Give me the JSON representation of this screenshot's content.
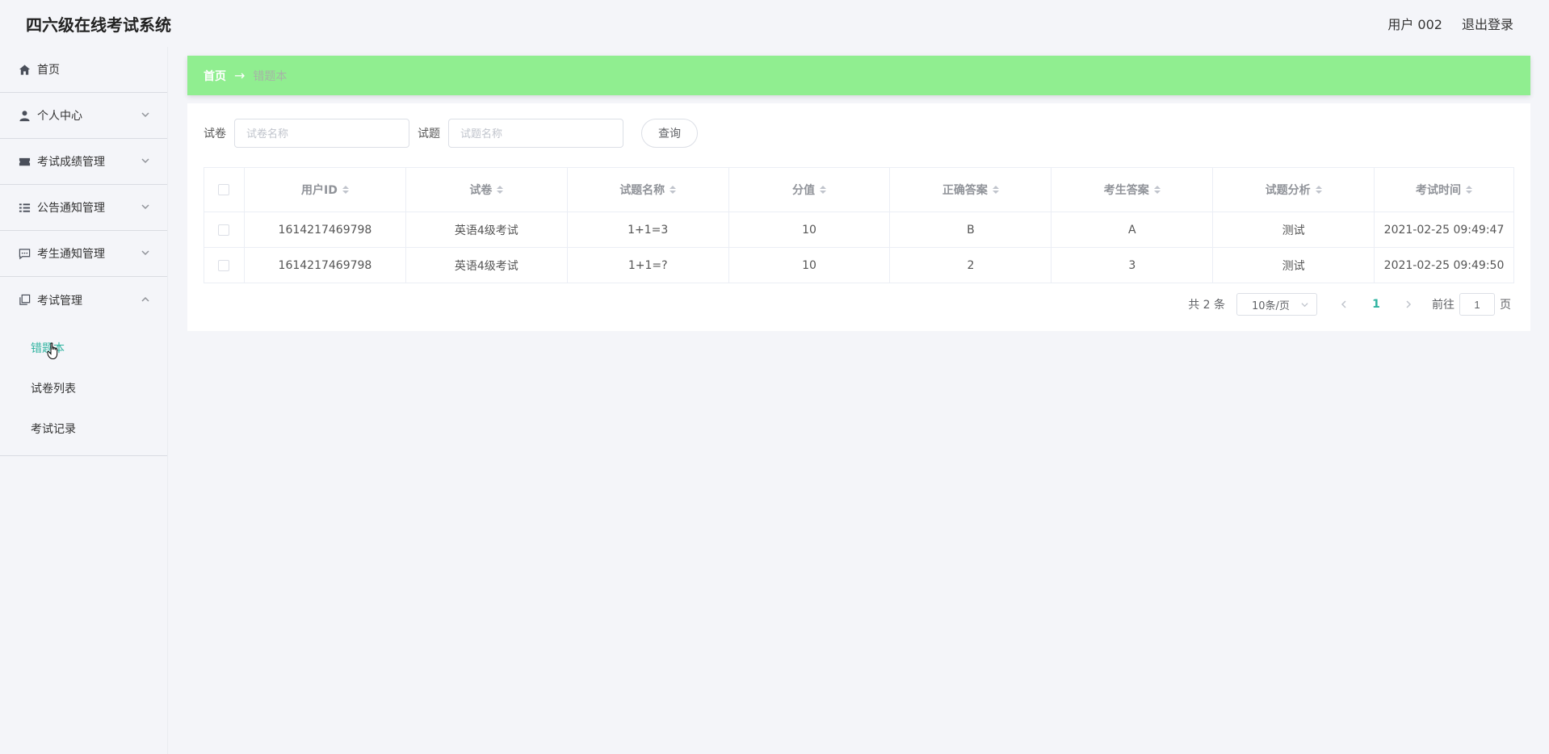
{
  "header": {
    "app_title": "四六级在线考试系统",
    "user_label": "用户 002",
    "logout_label": "退出登录"
  },
  "sidebar": {
    "items": [
      {
        "label": "首页",
        "icon": "home-icon"
      },
      {
        "label": "个人中心",
        "icon": "user-icon"
      },
      {
        "label": "考试成绩管理",
        "icon": "ticket-icon"
      },
      {
        "label": "公告通知管理",
        "icon": "list-icon"
      },
      {
        "label": "考生通知管理",
        "icon": "chat-icon"
      },
      {
        "label": "考试管理",
        "icon": "copy-icon"
      }
    ],
    "submenu": [
      {
        "label": "错题本",
        "active": true
      },
      {
        "label": "试卷列表"
      },
      {
        "label": "考试记录"
      }
    ]
  },
  "breadcrumb": {
    "home": "首页",
    "separator": "→",
    "current": "错题本"
  },
  "search": {
    "paper_label": "试卷",
    "paper_placeholder": "试卷名称",
    "question_label": "试题",
    "question_placeholder": "试题名称",
    "query_button": "查询"
  },
  "table": {
    "columns": [
      "用户ID",
      "试卷",
      "试题名称",
      "分值",
      "正确答案",
      "考生答案",
      "试题分析",
      "考试时间"
    ],
    "rows": [
      [
        "1614217469798",
        "英语4级考试",
        "1+1=3",
        "10",
        "B",
        "A",
        "测试",
        "2021-02-25 09:49:47"
      ],
      [
        "1614217469798",
        "英语4级考试",
        "1+1=?",
        "10",
        "2",
        "3",
        "测试",
        "2021-02-25 09:49:50"
      ]
    ]
  },
  "pagination": {
    "total": "共 2 条",
    "page_size": "10条/页",
    "current_page": "1",
    "goto_prefix": "前往",
    "goto_value": "1",
    "goto_suffix": "页"
  },
  "colors": {
    "breadcrumb_bg": "#90ee90",
    "accent": "#2fb3a0",
    "background": "#f4f5f9"
  }
}
